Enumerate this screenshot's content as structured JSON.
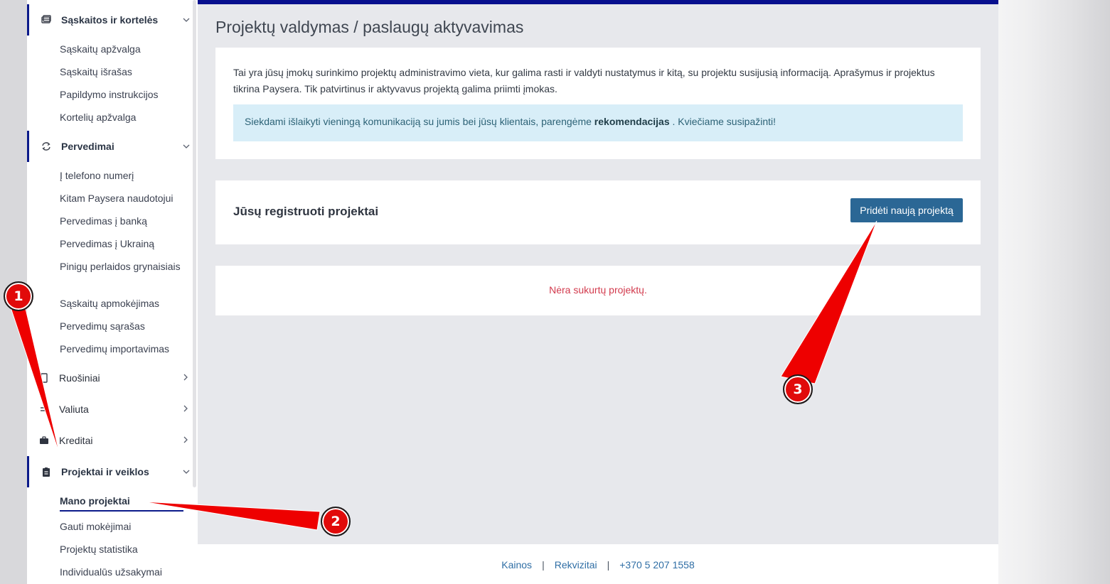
{
  "sidebar": {
    "groups": [
      {
        "label": "Sąskaitos ir kortelės",
        "icon": "cards-icon",
        "expanded": true
      },
      {
        "label": "Pervedimai",
        "icon": "transfer-icon",
        "expanded": true
      },
      {
        "label": "Ruošiniai",
        "icon": "template-icon",
        "expanded": false
      },
      {
        "label": "Valiuta",
        "icon": "currency-icon",
        "expanded": false
      },
      {
        "label": "Kreditai",
        "icon": "briefcase-icon",
        "expanded": false
      },
      {
        "label": "Projektai ir veiklos",
        "icon": "clipboard-icon",
        "expanded": true
      }
    ],
    "accounts_items": [
      "Sąskaitų apžvalga",
      "Sąskaitų išrašas",
      "Papildymo instrukcijos",
      "Kortelių apžvalga"
    ],
    "transfer_items": [
      "Į telefono numerį",
      "Kitam Paysera naudotojui",
      "Pervedimas į banką",
      "Pervedimas į Ukrainą",
      "Pinigų perlaidos grynaisiais",
      "Sąskaitų apmokėjimas",
      "Pervedimų sąrašas",
      "Pervedimų importavimas"
    ],
    "project_items": [
      "Mano projektai",
      "Gauti mokėjimai",
      "Projektų statistika",
      "Individualūs užsakymai"
    ],
    "active_item": "Mano projektai"
  },
  "main": {
    "title": "Projektų valdymas / paslaugų aktyvavimas",
    "intro": "Tai yra jūsų įmokų surinkimo projektų administravimo vieta, kur galima rasti ir valdyti nustatymus ir kitą, su projektu susijusią informaciją. Aprašymus ir projektus tikrina Paysera. Tik patvirtinus ir aktyvavus projektą galima priimti įmokas.",
    "notice": {
      "before": "Siekdami išlaikyti vieningą komunikaciją su jumis bei jūsų klientais, parengėme ",
      "link": "rekomendacijas",
      "after": " . Kviečiame susipažinti!"
    },
    "projects_title": "Jūsų registruoti projektai",
    "add_button": "Pridėti naują projektą",
    "empty_message": "Nėra sukurtų projektų."
  },
  "footer": {
    "links": [
      "Kainos",
      "Rekvizitai",
      "+370 5 207 1558"
    ],
    "separator": "|"
  },
  "annotations": [
    "1",
    "2",
    "3"
  ],
  "colors": {
    "brand_bar": "#08108e",
    "button": "#2b6795",
    "notice_bg": "#d8eef8",
    "error_text": "#d23a4d",
    "annotation": "#e10a0a"
  }
}
